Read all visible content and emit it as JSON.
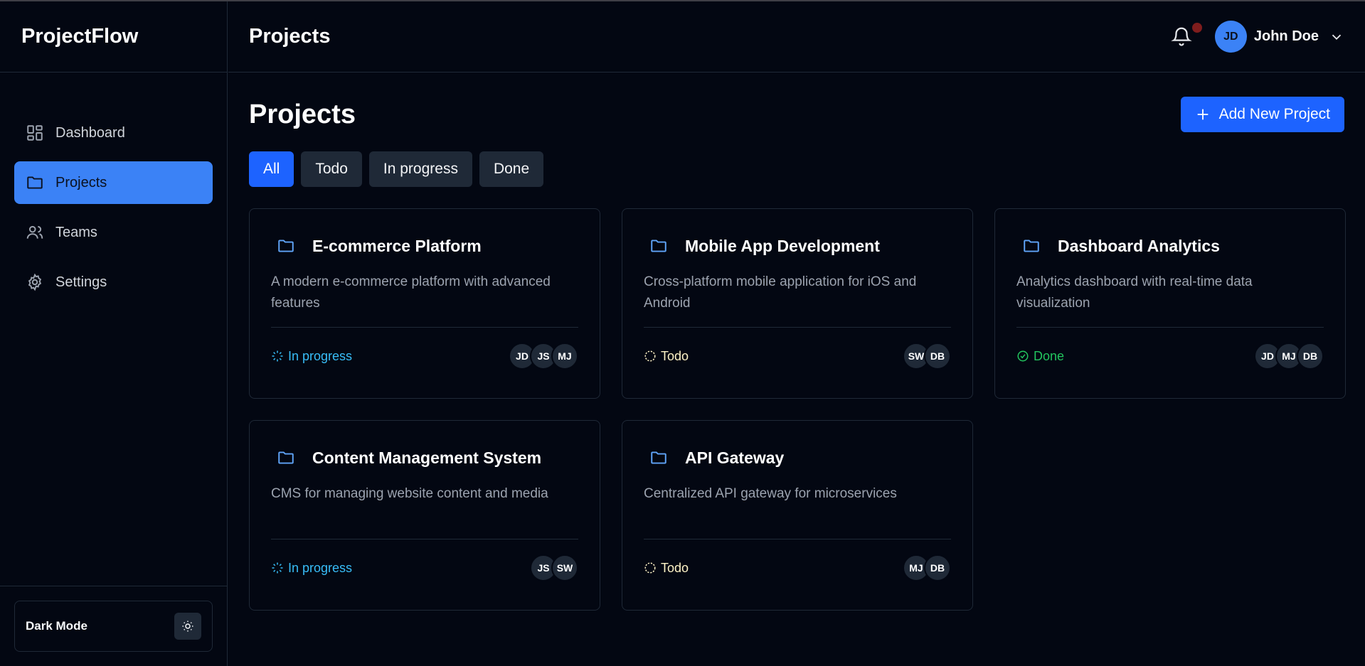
{
  "app": {
    "brand": "ProjectFlow"
  },
  "sidebar": {
    "items": [
      {
        "label": "Dashboard",
        "icon": "dashboard-icon",
        "active": false
      },
      {
        "label": "Projects",
        "icon": "folder-icon",
        "active": true
      },
      {
        "label": "Teams",
        "icon": "users-icon",
        "active": false
      },
      {
        "label": "Settings",
        "icon": "gear-icon",
        "active": false
      }
    ],
    "dark_mode_label": "Dark Mode"
  },
  "header": {
    "title": "Projects",
    "user": {
      "initials": "JD",
      "name": "John Doe"
    },
    "notification_dot": true
  },
  "main": {
    "title": "Projects",
    "add_button": "Add New Project",
    "filters": [
      {
        "label": "All",
        "active": true
      },
      {
        "label": "Todo",
        "active": false
      },
      {
        "label": "In progress",
        "active": false
      },
      {
        "label": "Done",
        "active": false
      }
    ],
    "projects": [
      {
        "title": "E-commerce Platform",
        "description": "A modern e-commerce platform with advanced features",
        "status": "In progress",
        "status_type": "progress",
        "members": [
          "JD",
          "JS",
          "MJ"
        ]
      },
      {
        "title": "Mobile App Development",
        "description": "Cross-platform mobile application for iOS and Android",
        "status": "Todo",
        "status_type": "todo",
        "members": [
          "SW",
          "DB"
        ]
      },
      {
        "title": "Dashboard Analytics",
        "description": "Analytics dashboard with real-time data visualization",
        "status": "Done",
        "status_type": "done",
        "members": [
          "JD",
          "MJ",
          "DB"
        ]
      },
      {
        "title": "Content Management System",
        "description": "CMS for managing website content and media",
        "status": "In progress",
        "status_type": "progress",
        "members": [
          "JS",
          "SW"
        ]
      },
      {
        "title": "API Gateway",
        "description": "Centralized API gateway for microservices",
        "status": "Todo",
        "status_type": "todo",
        "members": [
          "MJ",
          "DB"
        ]
      }
    ]
  },
  "colors": {
    "background": "#030712",
    "accent": "#1d63ff",
    "sidebar_active": "#3b82f6",
    "in_progress": "#38bdf8",
    "todo": "#fef3c7",
    "done": "#22c55e"
  }
}
